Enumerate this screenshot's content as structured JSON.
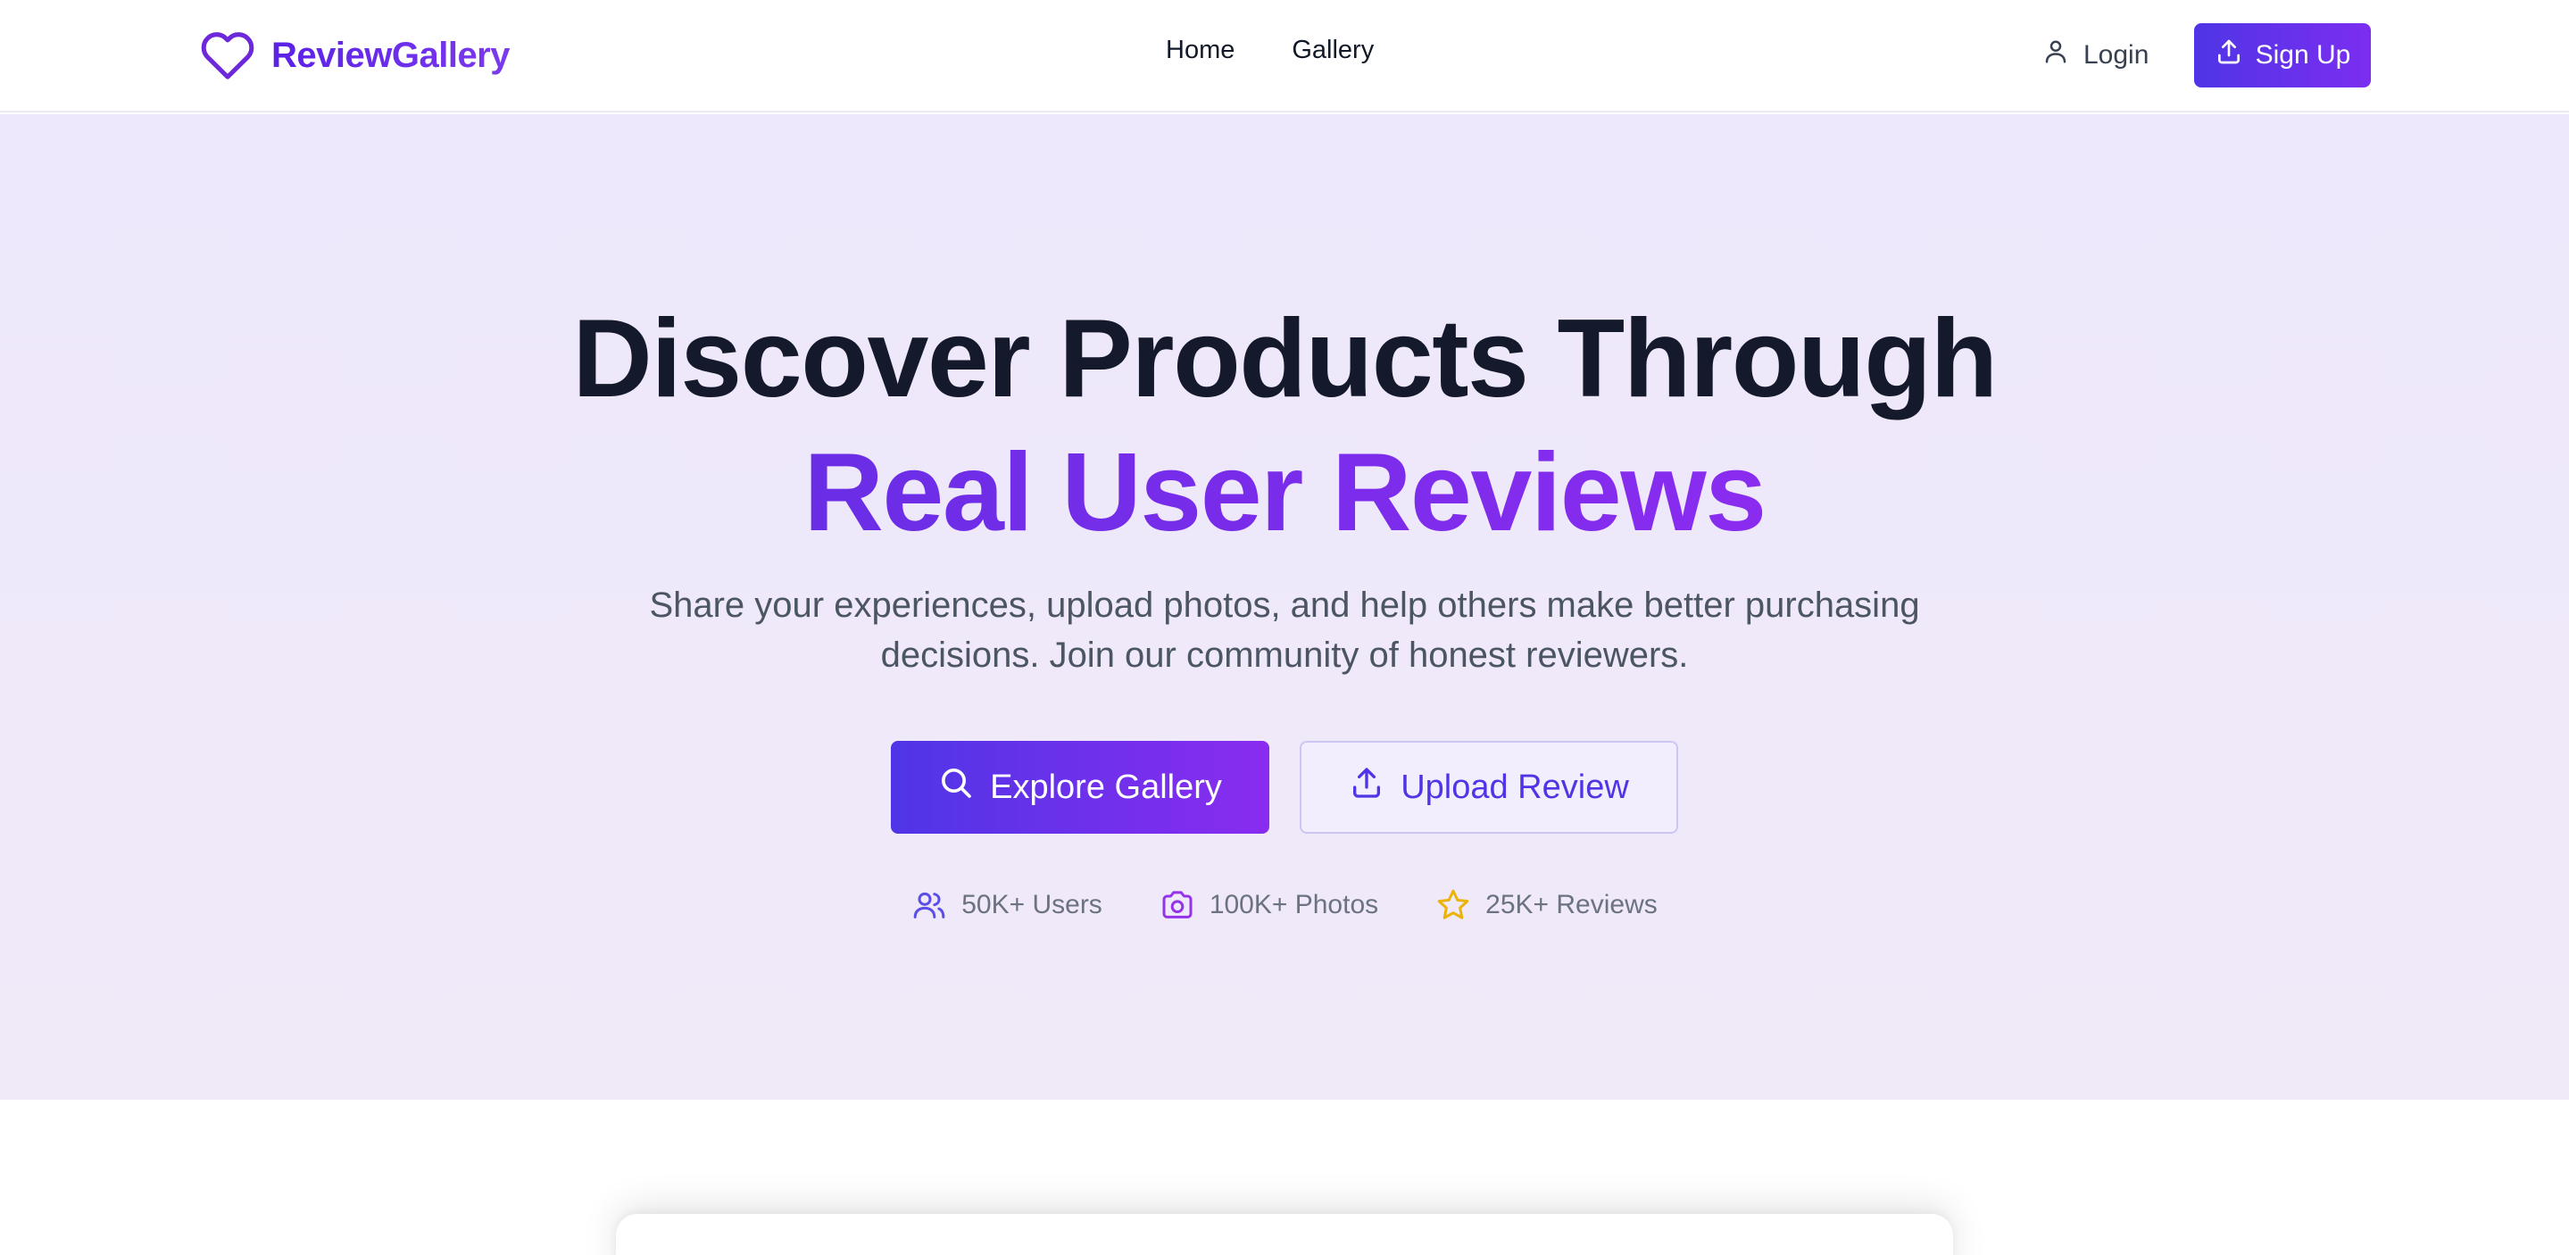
{
  "colors": {
    "brand": "#6d28d9",
    "accent_gradient_start": "#4f35e6",
    "accent_gradient_end": "#8a2cf0",
    "hero_background": "#efe9fa",
    "star": "#eab308"
  },
  "header": {
    "brand_name": "ReviewGallery",
    "brand_icon": "heart-icon",
    "nav": [
      {
        "label": "Home"
      },
      {
        "label": "Gallery"
      }
    ],
    "login_label": "Login",
    "login_icon": "user-icon",
    "signup_label": "Sign Up",
    "signup_icon": "upload-icon"
  },
  "hero": {
    "headline_line1": "Discover Products Through",
    "headline_line2": "Real User Reviews",
    "subtitle": "Share your experiences, upload photos, and help others make better purchasing decisions. Join our community of honest reviewers.",
    "primary_cta": {
      "label": "Explore Gallery",
      "icon": "search-icon"
    },
    "secondary_cta": {
      "label": "Upload Review",
      "icon": "upload-icon"
    },
    "stats": [
      {
        "label": "50K+ Users",
        "icon": "users-icon"
      },
      {
        "label": "100K+ Photos",
        "icon": "camera-icon"
      },
      {
        "label": "25K+ Reviews",
        "icon": "star-icon"
      }
    ]
  }
}
